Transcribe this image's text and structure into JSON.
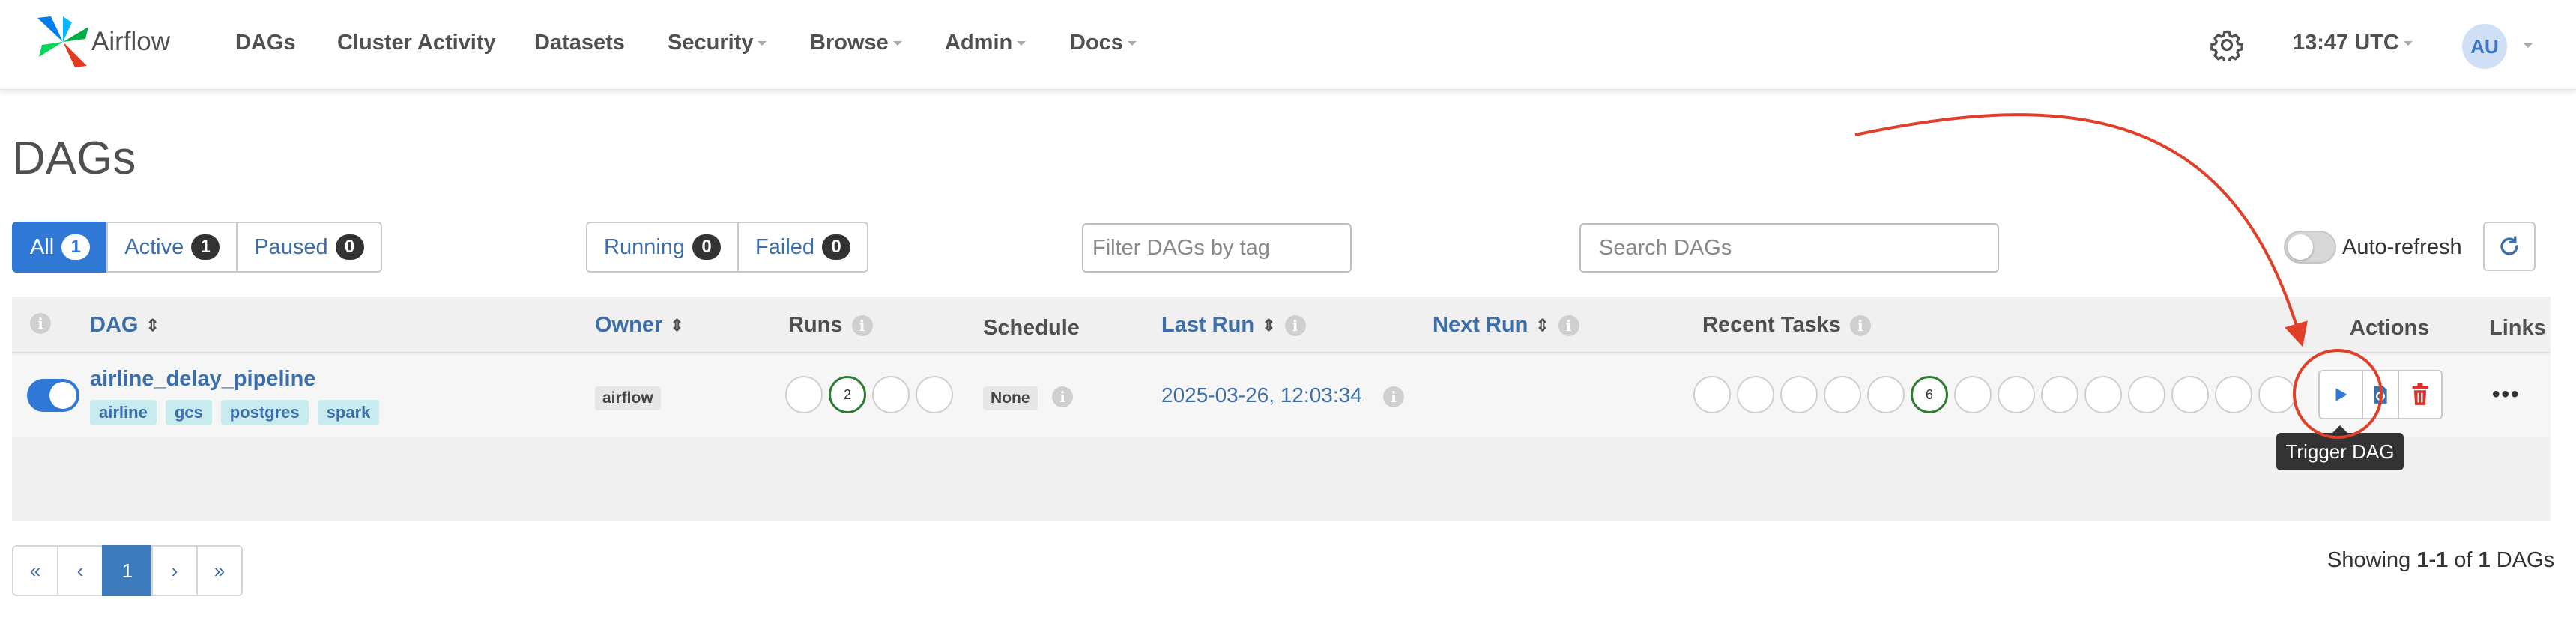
{
  "navbar": {
    "brand": "Airflow",
    "items": [
      {
        "label": "DAGs",
        "dropdown": false
      },
      {
        "label": "Cluster Activity",
        "dropdown": false
      },
      {
        "label": "Datasets",
        "dropdown": false
      },
      {
        "label": "Security",
        "dropdown": true
      },
      {
        "label": "Browse",
        "dropdown": true
      },
      {
        "label": "Admin",
        "dropdown": true
      },
      {
        "label": "Docs",
        "dropdown": true
      }
    ],
    "time": "13:47 UTC",
    "user_initials": "AU",
    "icons": {
      "settings": "gear-icon"
    }
  },
  "page": {
    "title": "DAGs"
  },
  "status_filter": [
    {
      "label": "All",
      "count": "1",
      "active": true
    },
    {
      "label": "Active",
      "count": "1",
      "active": false
    },
    {
      "label": "Paused",
      "count": "0",
      "active": false
    }
  ],
  "run_filter": [
    {
      "label": "Running",
      "count": "0"
    },
    {
      "label": "Failed",
      "count": "0"
    }
  ],
  "tag_filter": {
    "placeholder": "Filter DAGs by tag"
  },
  "search": {
    "placeholder": "Search DAGs"
  },
  "auto_refresh": {
    "label": "Auto-refresh",
    "enabled": false
  },
  "table": {
    "headers": {
      "dag": "DAG",
      "owner": "Owner",
      "runs": "Runs",
      "schedule": "Schedule",
      "last_run": "Last Run",
      "next_run": "Next Run",
      "recent_tasks": "Recent Tasks",
      "actions": "Actions",
      "links": "Links"
    },
    "rows": [
      {
        "enabled": true,
        "dag_id": "airline_delay_pipeline",
        "tags": [
          "airline",
          "gcs",
          "postgres",
          "spark"
        ],
        "owner": "airflow",
        "runs": [
          "",
          "2",
          "",
          ""
        ],
        "schedule": "None",
        "last_run": "2025-03-26, 12:03:34",
        "next_run": "",
        "recent_tasks": [
          "",
          "",
          "",
          "",
          "",
          "6",
          "",
          "",
          "",
          "",
          "",
          "",
          "",
          ""
        ],
        "actions": [
          "trigger-dag",
          "refresh-dag",
          "delete-dag"
        ],
        "links_icon": "more-icon"
      }
    ]
  },
  "tooltip": {
    "text": "Trigger DAG"
  },
  "colors": {
    "primary": "#2f78d5",
    "link": "#3c6ea9",
    "success": "#2e7d32",
    "annotation": "#e0402a",
    "delete": "#d9302a"
  },
  "pagination": {
    "items": [
      "«",
      "‹",
      "1",
      "›",
      "»"
    ],
    "active": "1"
  },
  "summary": {
    "prefix": "Showing",
    "range": "1-1",
    "of": "of",
    "total": "1",
    "suffix": "DAGs"
  }
}
